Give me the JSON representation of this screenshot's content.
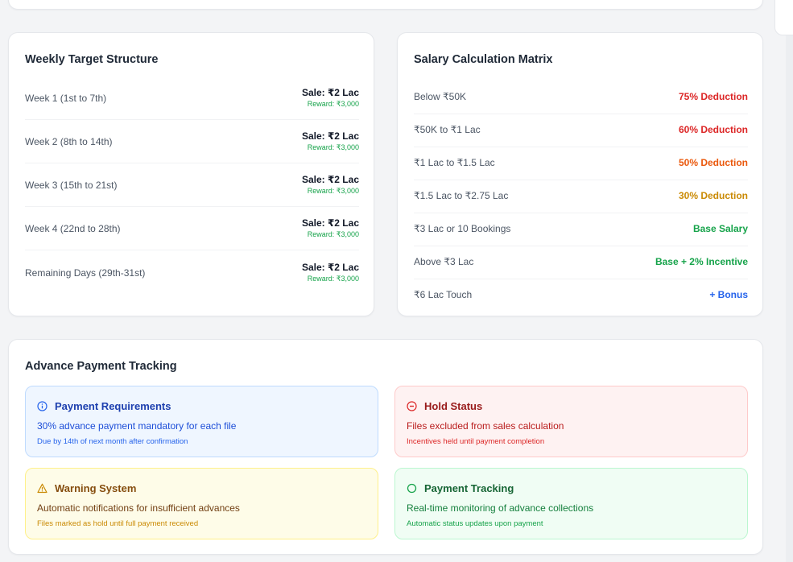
{
  "weekly": {
    "title": "Weekly Target Structure",
    "rows": [
      {
        "label": "Week 1 (1st to 7th)",
        "sale": "Sale: ₹2 Lac",
        "reward": "Reward: ₹3,000"
      },
      {
        "label": "Week 2 (8th to 14th)",
        "sale": "Sale: ₹2 Lac",
        "reward": "Reward: ₹3,000"
      },
      {
        "label": "Week 3 (15th to 21st)",
        "sale": "Sale: ₹2 Lac",
        "reward": "Reward: ₹3,000"
      },
      {
        "label": "Week 4 (22nd to 28th)",
        "sale": "Sale: ₹2 Lac",
        "reward": "Reward: ₹3,000"
      },
      {
        "label": "Remaining Days (29th-31st)",
        "sale": "Sale: ₹2 Lac",
        "reward": "Reward: ₹3,000"
      }
    ]
  },
  "salary": {
    "title": "Salary Calculation Matrix",
    "rows": [
      {
        "label": "Below ₹50K",
        "value": "75% Deduction",
        "color": "#dc2626"
      },
      {
        "label": "₹50K to ₹1 Lac",
        "value": "60% Deduction",
        "color": "#dc2626"
      },
      {
        "label": "₹1 Lac to ₹1.5 Lac",
        "value": "50% Deduction",
        "color": "#ea580c"
      },
      {
        "label": "₹1.5 Lac to ₹2.75 Lac",
        "value": "30% Deduction",
        "color": "#ca8a04"
      },
      {
        "label": "₹3 Lac or 10 Bookings",
        "value": "Base Salary",
        "color": "#16a34a"
      },
      {
        "label": "Above ₹3 Lac",
        "value": "Base + 2% Incentive",
        "color": "#16a34a"
      },
      {
        "label": "₹6 Lac Touch",
        "value": "+ Bonus",
        "color": "#2563eb"
      }
    ]
  },
  "advance": {
    "title": "Advance Payment Tracking",
    "boxes": [
      {
        "icon": "info-icon",
        "title": "Payment Requirements",
        "desc": "30% advance payment mandatory for each file",
        "note": "Due by 14th of next month after confirmation"
      },
      {
        "icon": "hold-icon",
        "title": "Hold Status",
        "desc": "Files excluded from sales calculation",
        "note": "Incentives held until payment completion"
      },
      {
        "icon": "warning-icon",
        "title": "Warning System",
        "desc": "Automatic notifications for insufficient advances",
        "note": "Files marked as hold until full payment received"
      },
      {
        "icon": "circle-icon",
        "title": "Payment Tracking",
        "desc": "Real-time monitoring of advance collections",
        "note": "Automatic status updates upon payment"
      }
    ]
  }
}
